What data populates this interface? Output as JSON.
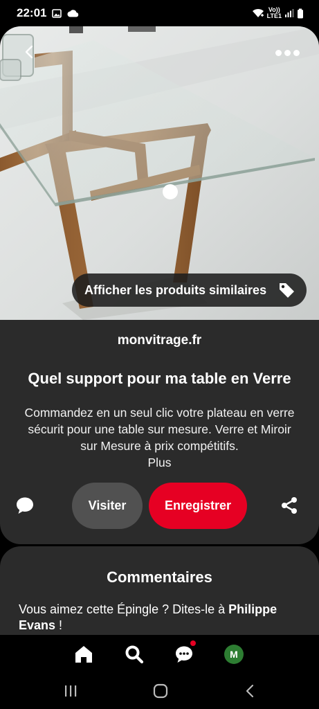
{
  "status_bar": {
    "time": "22:01",
    "left_icons": [
      "image-icon",
      "cloud-icon"
    ],
    "right_icons": [
      "wifi-icon",
      "signal-icon",
      "battery-icon"
    ],
    "volte_top": "Vo))",
    "volte_bottom": "LTE1"
  },
  "pin": {
    "image_alt": "glass-table-image",
    "similar_products_label": "Afficher les produits similaires",
    "source": "monvitrage.fr",
    "title": "Quel support pour ma table en Verre",
    "description": "Commandez en un seul clic votre plateau en verre sécurit pour une table sur mesure. Verre et Miroir sur Mesure à prix compétitifs.",
    "more_label": "Plus",
    "visit_label": "Visiter",
    "save_label": "Enregistrer"
  },
  "comments": {
    "title": "Commentaires",
    "prompt_prefix": "Vous aimez cette Épingle ? Dites-le à ",
    "author": "Philippe Evans",
    "prompt_suffix": " !"
  },
  "bottom_nav": {
    "items": [
      "home-icon",
      "search-icon",
      "messages-icon",
      "profile-avatar"
    ],
    "avatar_initial": "M",
    "avatar_color": "#2d7d32",
    "notification": true
  },
  "colors": {
    "accent_red": "#e60023",
    "card_bg": "#2b2b2b",
    "visit_bg": "#515151"
  }
}
